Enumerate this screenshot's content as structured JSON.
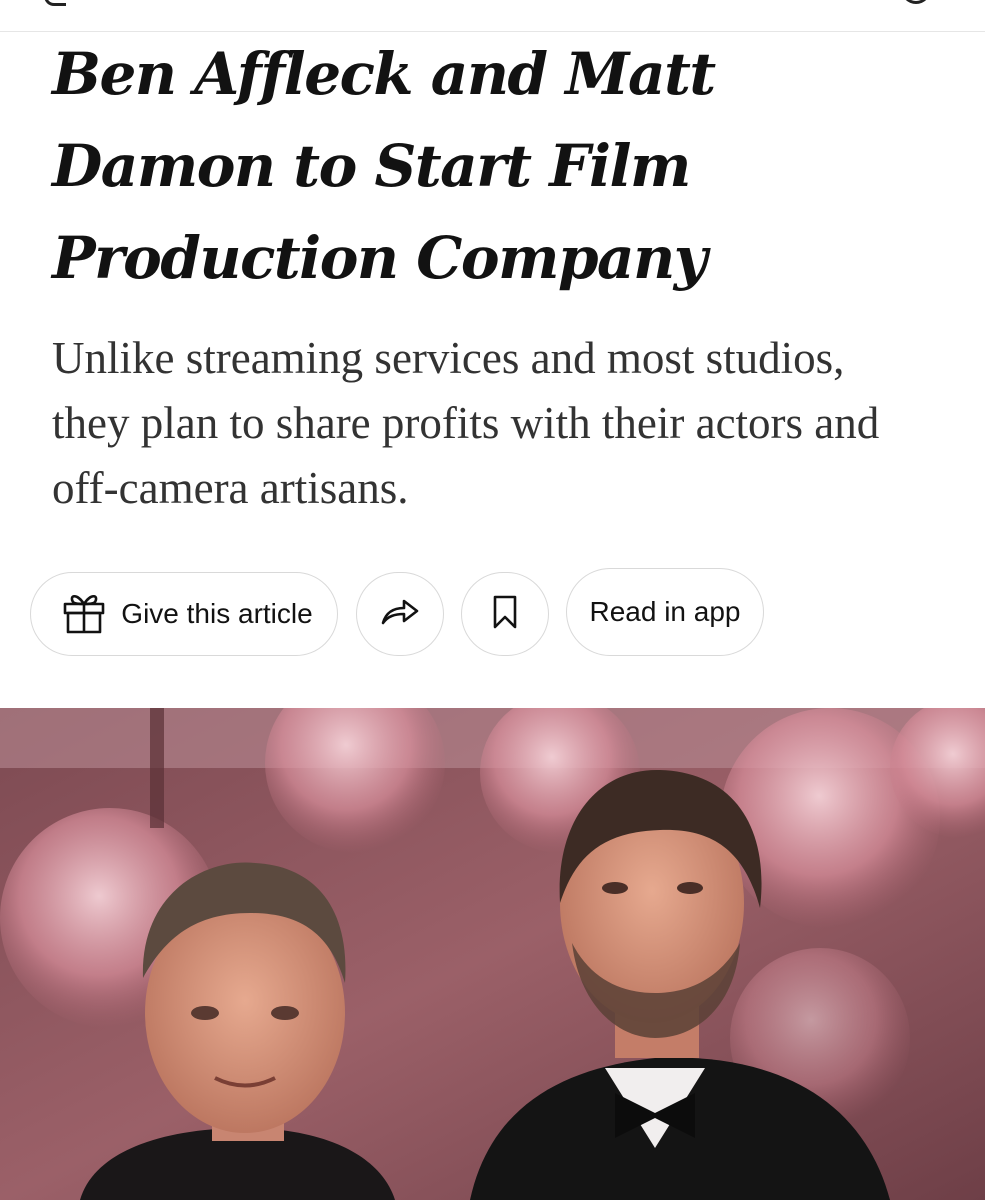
{
  "article": {
    "headline": "Ben Affleck and Matt Damon to Start Film Production Company",
    "summary": "Unlike streaming services and most studios, they plan to share profits with their actors and off-camera artisans."
  },
  "actions": {
    "gift_label": "Give this article",
    "read_in_app_label": "Read in app",
    "icons": {
      "gift": "gift-icon",
      "share": "share-arrow-icon",
      "save": "bookmark-icon"
    }
  },
  "colors": {
    "text": "#121212",
    "summary_text": "#333333",
    "pill_border": "#d9d9d9"
  }
}
